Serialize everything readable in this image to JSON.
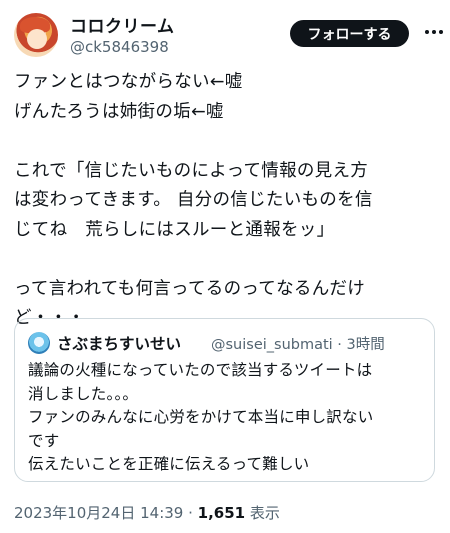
{
  "author": {
    "name": "コロクリーム",
    "handle": "@ck5846398"
  },
  "follow_label": "フォローする",
  "tweet": {
    "lines": [
      "ファンとはつながらない←嘘",
      "げんたろうは姉街の垢←嘘",
      "",
      "これで「信じたいものによって情報の見え方",
      "は変わってきます。 自分の信じたいものを信",
      "じてね　荒らしにはスルーと通報をッ」",
      "",
      "って言われても何言ってるのってなるんだけ",
      "ど・・・"
    ]
  },
  "quote": {
    "name": "さぶまちすいせい",
    "meta": "@suisei_submati · 3時間",
    "lines": [
      "議論の火種になっていたので該当するツイートは",
      "消しました。。。",
      "ファンのみんなに心労をかけて本当に申し訳ない",
      "です",
      "伝えたいことを正確に伝えるって難しい"
    ]
  },
  "footer": {
    "datetime": "2023年10月24日 14:39",
    "separator": " · ",
    "views": "1,651",
    "views_label": " 表示"
  },
  "colors": {
    "text": "#0f1419",
    "secondary": "#536471",
    "follow_bg": "#0f1419",
    "border": "#cfd9de"
  },
  "icons": {
    "more": "more-horizontal-icon"
  }
}
